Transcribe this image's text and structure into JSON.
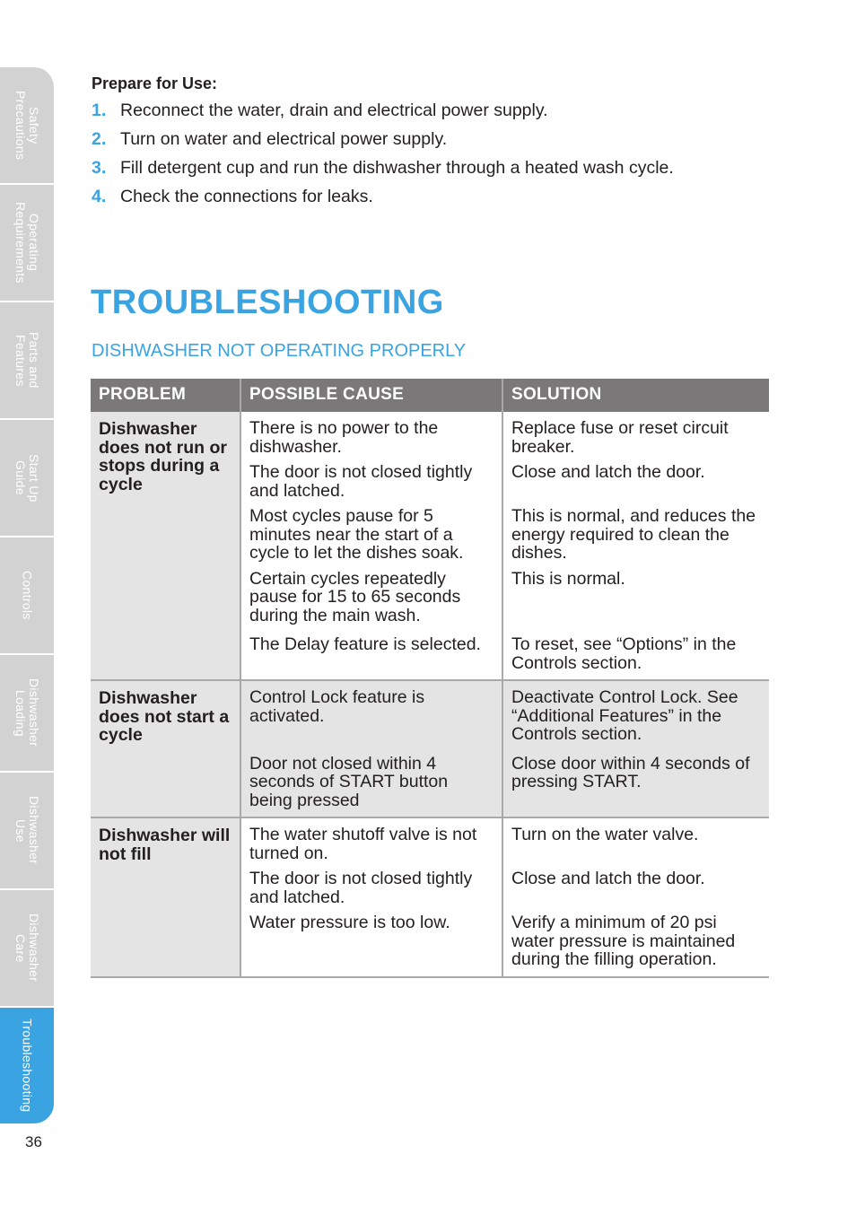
{
  "side_tabs": [
    {
      "label": "Safety\nPrecautions",
      "active": false
    },
    {
      "label": "Operating\nRequirements",
      "active": false
    },
    {
      "label": "Parts and\nFeatures",
      "active": false
    },
    {
      "label": "Start Up\nGuide",
      "active": false
    },
    {
      "label": "Controls",
      "active": false
    },
    {
      "label": "Dishwasher\nLoading",
      "active": false
    },
    {
      "label": "Dishwasher\nUse",
      "active": false
    },
    {
      "label": "Dishwasher\nCare",
      "active": false
    },
    {
      "label": "Troubleshooting",
      "active": true
    }
  ],
  "page_number": "36",
  "prepare": {
    "title": "Prepare for Use:",
    "steps": [
      {
        "num": "1.",
        "text": "Reconnect the water, drain and electrical power supply."
      },
      {
        "num": "2.",
        "text": "Turn on water and electrical power supply."
      },
      {
        "num": "3.",
        "text": "Fill detergent cup and run the dishwasher through a heated wash cycle."
      },
      {
        "num": "4.",
        "text": "Check the connections for leaks."
      }
    ]
  },
  "page_title": "TROUBLESHOOTING",
  "section_title": "DISHWASHER NOT OPERATING PROPERLY",
  "table": {
    "headers": [
      "PROBLEM",
      "POSSIBLE CAUSE",
      "SOLUTION"
    ],
    "groups": [
      {
        "problem": "Dishwasher does not run or stops during a cycle",
        "rows": [
          {
            "cause": "There is no power to the dishwasher.",
            "solution": "Replace fuse or reset circuit breaker."
          },
          {
            "cause": "The door is not closed tightly and latched.",
            "solution": "Close and latch the door."
          },
          {
            "cause": "Most cycles pause for 5 minutes near the start of a cycle to let the dishes soak.",
            "solution": "This is normal, and reduces the energy required to clean the dishes."
          },
          {
            "cause": "Certain cycles repeatedly pause for 15 to 65 seconds during the main wash.",
            "solution": "This is normal."
          },
          {
            "cause": "The Delay feature is selected.",
            "solution": "To reset, see “Options” in the Controls section."
          }
        ]
      },
      {
        "problem": "Dishwasher does not start a cycle",
        "rows": [
          {
            "cause": "Control Lock feature is activated.",
            "solution": "Deactivate Control Lock. See “Additional Features” in the Controls section."
          },
          {
            "cause": "Door not closed within 4 seconds of START button being pressed",
            "solution": "Close door within 4 seconds of pressing START."
          }
        ]
      },
      {
        "problem": "Dishwasher will not fill",
        "rows": [
          {
            "cause": "The water shutoff valve is not turned on.",
            "solution": "Turn on the water valve."
          },
          {
            "cause": "The door is not closed tightly and latched.",
            "solution": "Close and latch the door."
          },
          {
            "cause": "Water pressure is too low.",
            "solution": "Verify a minimum of 20 psi water pressure is maintained during the filling operation."
          }
        ]
      }
    ]
  }
}
